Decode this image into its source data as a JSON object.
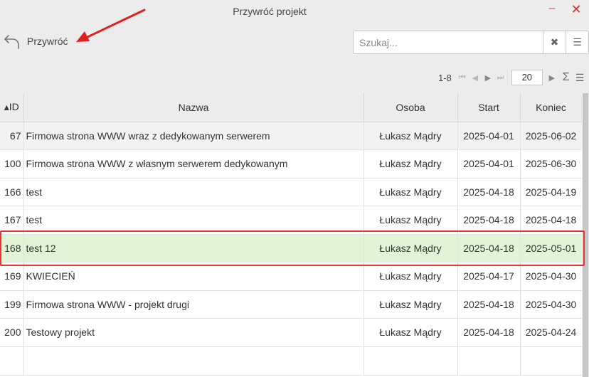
{
  "window": {
    "title": "Przywróć projekt",
    "minimize_glyph": "–",
    "close_glyph": "✕"
  },
  "toolbar": {
    "restore_label": "Przywróć",
    "restore_icon": "undo-arrow-icon"
  },
  "search": {
    "placeholder": "Szukaj...",
    "value": "",
    "clear_glyph": "✖",
    "menu_glyph": "☰"
  },
  "pager": {
    "range": "1-8",
    "first": "⏮",
    "prev": "◀",
    "next": "▶",
    "last": "⏭",
    "page_size": "20",
    "sum_glyph": "Σ",
    "menu_glyph": "☰"
  },
  "grid": {
    "columns": {
      "id": "▴ID",
      "name": "Nazwa",
      "person": "Osoba",
      "start": "Start",
      "end": "Koniec"
    },
    "rows": [
      {
        "id": "67",
        "name": "Firmowa strona WWW wraz z dedykowanym serwerem",
        "person": "Łukasz Mądry",
        "start": "2025-04-01",
        "end": "2025-06-02"
      },
      {
        "id": "100",
        "name": "Firmowa strona WWW z własnym serwerem dedykowanym",
        "person": "Łukasz Mądry",
        "start": "2025-04-01",
        "end": "2025-06-30"
      },
      {
        "id": "166",
        "name": "test",
        "person": "Łukasz Mądry",
        "start": "2025-04-18",
        "end": "2025-04-19"
      },
      {
        "id": "167",
        "name": "test",
        "person": "Łukasz Mądry",
        "start": "2025-04-18",
        "end": "2025-04-18"
      },
      {
        "id": "168",
        "name": "test 12",
        "person": "Łukasz Mądry",
        "start": "2025-04-18",
        "end": "2025-05-01"
      },
      {
        "id": "169",
        "name": "KWIECIEŃ",
        "person": "Łukasz Mądry",
        "start": "2025-04-17",
        "end": "2025-04-30"
      },
      {
        "id": "199",
        "name": "Firmowa strona WWW - projekt drugi",
        "person": "Łukasz Mądry",
        "start": "2025-04-18",
        "end": "2025-04-30"
      },
      {
        "id": "200",
        "name": "Testowy projekt",
        "person": "Łukasz Mądry",
        "start": "2025-04-18",
        "end": "2025-04-24"
      }
    ]
  },
  "colors": {
    "selected_row": "#e3f3d8",
    "highlight": "#e53535",
    "annotation_arrow": "#e02020"
  }
}
